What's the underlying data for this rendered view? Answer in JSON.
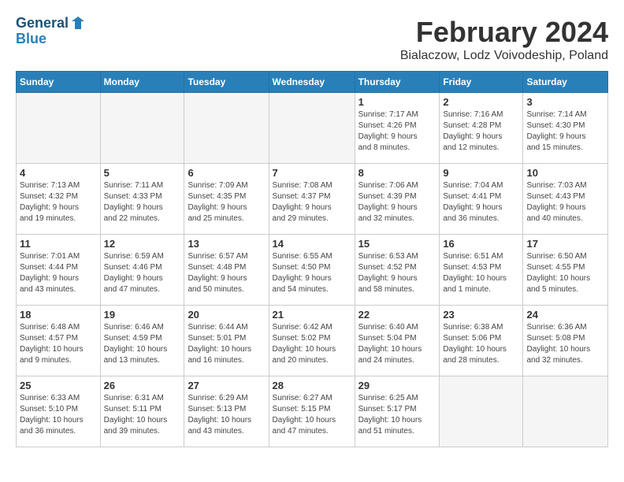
{
  "header": {
    "logo_line1": "General",
    "logo_line2": "Blue",
    "title": "February 2024",
    "subtitle": "Bialaczow, Lodz Voivodeship, Poland"
  },
  "weekdays": [
    "Sunday",
    "Monday",
    "Tuesday",
    "Wednesday",
    "Thursday",
    "Friday",
    "Saturday"
  ],
  "weeks": [
    [
      {
        "day": "",
        "info": ""
      },
      {
        "day": "",
        "info": ""
      },
      {
        "day": "",
        "info": ""
      },
      {
        "day": "",
        "info": ""
      },
      {
        "day": "1",
        "info": "Sunrise: 7:17 AM\nSunset: 4:26 PM\nDaylight: 9 hours\nand 8 minutes."
      },
      {
        "day": "2",
        "info": "Sunrise: 7:16 AM\nSunset: 4:28 PM\nDaylight: 9 hours\nand 12 minutes."
      },
      {
        "day": "3",
        "info": "Sunrise: 7:14 AM\nSunset: 4:30 PM\nDaylight: 9 hours\nand 15 minutes."
      }
    ],
    [
      {
        "day": "4",
        "info": "Sunrise: 7:13 AM\nSunset: 4:32 PM\nDaylight: 9 hours\nand 19 minutes."
      },
      {
        "day": "5",
        "info": "Sunrise: 7:11 AM\nSunset: 4:33 PM\nDaylight: 9 hours\nand 22 minutes."
      },
      {
        "day": "6",
        "info": "Sunrise: 7:09 AM\nSunset: 4:35 PM\nDaylight: 9 hours\nand 25 minutes."
      },
      {
        "day": "7",
        "info": "Sunrise: 7:08 AM\nSunset: 4:37 PM\nDaylight: 9 hours\nand 29 minutes."
      },
      {
        "day": "8",
        "info": "Sunrise: 7:06 AM\nSunset: 4:39 PM\nDaylight: 9 hours\nand 32 minutes."
      },
      {
        "day": "9",
        "info": "Sunrise: 7:04 AM\nSunset: 4:41 PM\nDaylight: 9 hours\nand 36 minutes."
      },
      {
        "day": "10",
        "info": "Sunrise: 7:03 AM\nSunset: 4:43 PM\nDaylight: 9 hours\nand 40 minutes."
      }
    ],
    [
      {
        "day": "11",
        "info": "Sunrise: 7:01 AM\nSunset: 4:44 PM\nDaylight: 9 hours\nand 43 minutes."
      },
      {
        "day": "12",
        "info": "Sunrise: 6:59 AM\nSunset: 4:46 PM\nDaylight: 9 hours\nand 47 minutes."
      },
      {
        "day": "13",
        "info": "Sunrise: 6:57 AM\nSunset: 4:48 PM\nDaylight: 9 hours\nand 50 minutes."
      },
      {
        "day": "14",
        "info": "Sunrise: 6:55 AM\nSunset: 4:50 PM\nDaylight: 9 hours\nand 54 minutes."
      },
      {
        "day": "15",
        "info": "Sunrise: 6:53 AM\nSunset: 4:52 PM\nDaylight: 9 hours\nand 58 minutes."
      },
      {
        "day": "16",
        "info": "Sunrise: 6:51 AM\nSunset: 4:53 PM\nDaylight: 10 hours\nand 1 minute."
      },
      {
        "day": "17",
        "info": "Sunrise: 6:50 AM\nSunset: 4:55 PM\nDaylight: 10 hours\nand 5 minutes."
      }
    ],
    [
      {
        "day": "18",
        "info": "Sunrise: 6:48 AM\nSunset: 4:57 PM\nDaylight: 10 hours\nand 9 minutes."
      },
      {
        "day": "19",
        "info": "Sunrise: 6:46 AM\nSunset: 4:59 PM\nDaylight: 10 hours\nand 13 minutes."
      },
      {
        "day": "20",
        "info": "Sunrise: 6:44 AM\nSunset: 5:01 PM\nDaylight: 10 hours\nand 16 minutes."
      },
      {
        "day": "21",
        "info": "Sunrise: 6:42 AM\nSunset: 5:02 PM\nDaylight: 10 hours\nand 20 minutes."
      },
      {
        "day": "22",
        "info": "Sunrise: 6:40 AM\nSunset: 5:04 PM\nDaylight: 10 hours\nand 24 minutes."
      },
      {
        "day": "23",
        "info": "Sunrise: 6:38 AM\nSunset: 5:06 PM\nDaylight: 10 hours\nand 28 minutes."
      },
      {
        "day": "24",
        "info": "Sunrise: 6:36 AM\nSunset: 5:08 PM\nDaylight: 10 hours\nand 32 minutes."
      }
    ],
    [
      {
        "day": "25",
        "info": "Sunrise: 6:33 AM\nSunset: 5:10 PM\nDaylight: 10 hours\nand 36 minutes."
      },
      {
        "day": "26",
        "info": "Sunrise: 6:31 AM\nSunset: 5:11 PM\nDaylight: 10 hours\nand 39 minutes."
      },
      {
        "day": "27",
        "info": "Sunrise: 6:29 AM\nSunset: 5:13 PM\nDaylight: 10 hours\nand 43 minutes."
      },
      {
        "day": "28",
        "info": "Sunrise: 6:27 AM\nSunset: 5:15 PM\nDaylight: 10 hours\nand 47 minutes."
      },
      {
        "day": "29",
        "info": "Sunrise: 6:25 AM\nSunset: 5:17 PM\nDaylight: 10 hours\nand 51 minutes."
      },
      {
        "day": "",
        "info": ""
      },
      {
        "day": "",
        "info": ""
      }
    ]
  ]
}
